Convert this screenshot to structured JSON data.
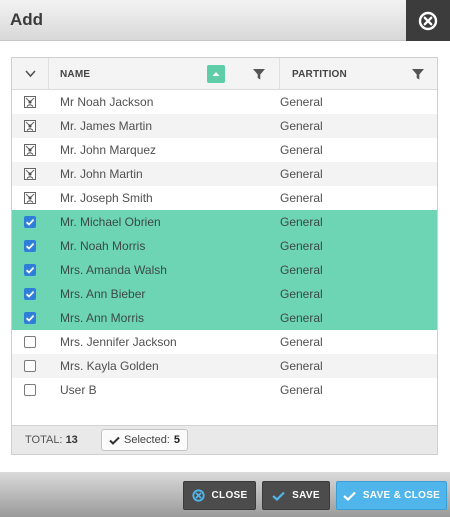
{
  "dialog": {
    "title": "Add"
  },
  "grid": {
    "columns": {
      "name": "NAME",
      "partition": "PARTITION"
    },
    "rows": [
      {
        "name": "Mr Noah Jackson",
        "partition": "General",
        "state": "icon"
      },
      {
        "name": "Mr. James Martin",
        "partition": "General",
        "state": "icon"
      },
      {
        "name": "Mr. John Marquez",
        "partition": "General",
        "state": "icon"
      },
      {
        "name": "Mr. John Martin",
        "partition": "General",
        "state": "icon"
      },
      {
        "name": "Mr. Joseph Smith",
        "partition": "General",
        "state": "icon"
      },
      {
        "name": "Mr. Michael Obrien",
        "partition": "General",
        "state": "checked"
      },
      {
        "name": "Mr. Noah Morris",
        "partition": "General",
        "state": "checked"
      },
      {
        "name": "Mrs. Amanda Walsh",
        "partition": "General",
        "state": "checked"
      },
      {
        "name": "Mrs. Ann Bieber",
        "partition": "General",
        "state": "checked"
      },
      {
        "name": "Mrs. Ann Morris",
        "partition": "General",
        "state": "checked"
      },
      {
        "name": "Mrs. Jennifer Jackson",
        "partition": "General",
        "state": "unchecked"
      },
      {
        "name": "Mrs. Kayla Golden",
        "partition": "General",
        "state": "unchecked"
      },
      {
        "name": "User B",
        "partition": "General",
        "state": "unchecked"
      }
    ],
    "footer": {
      "total_label": "TOTAL:",
      "total_value": "13",
      "selected_label": "Selected:",
      "selected_value": "5"
    }
  },
  "buttons": {
    "close": "CLOSE",
    "save": "SAVE",
    "save_close": "SAVE & CLOSE"
  },
  "colors": {
    "selected_row": "#6dd5b3",
    "sort_button": "#5fcea8",
    "checkbox_blue": "#2f7fd8",
    "primary_button": "#4fb5ea",
    "dark_button": "#4c4c4c"
  },
  "icons": {
    "dialog_close": "close-circle-icon",
    "select_all": "chevron-down-icon",
    "sort": "sort-ascending-icon",
    "filter": "filter-icon",
    "row_type": "user-badge-icon",
    "footer_close": "close-circle-icon",
    "save": "checkmark-icon"
  }
}
